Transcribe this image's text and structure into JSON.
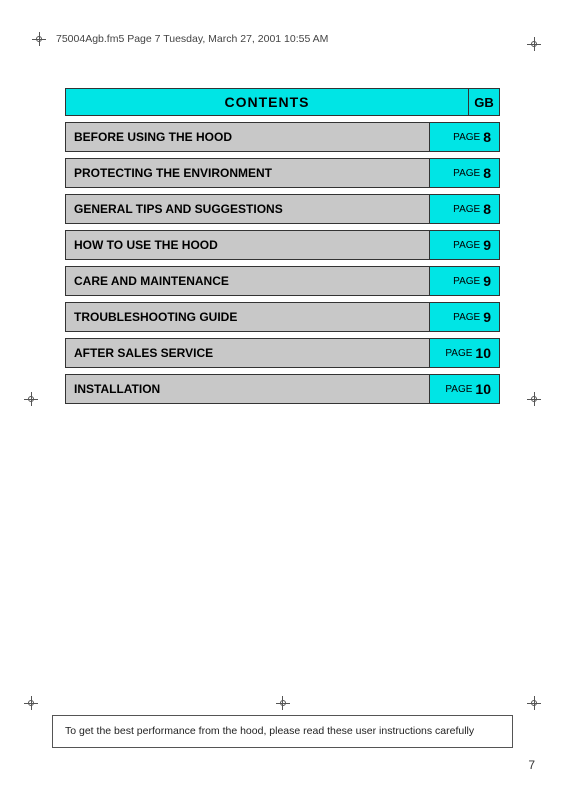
{
  "header": {
    "file_info": "75004Agb.fm5  Page 7  Tuesday, March 27, 2001  10:55 AM"
  },
  "contents": {
    "title": "CONTENTS",
    "gb_label": "GB",
    "rows": [
      {
        "label": "BEFORE USING THE HOOD",
        "page_word": "PAGE",
        "page_num": "8"
      },
      {
        "label": "PROTECTING THE ENVIRONMENT",
        "page_word": "PAGE",
        "page_num": "8"
      },
      {
        "label": "GENERAL TIPS AND SUGGESTIONS",
        "page_word": "PAGE",
        "page_num": "8"
      },
      {
        "label": "HOW TO USE THE HOOD",
        "page_word": "PAGE",
        "page_num": "9"
      },
      {
        "label": "CARE AND MAINTENANCE",
        "page_word": "PAGE",
        "page_num": "9"
      },
      {
        "label": "TROUBLESHOOTING GUIDE",
        "page_word": "PAGE",
        "page_num": "9"
      },
      {
        "label": "AFTER SALES SERVICE",
        "page_word": "PAGE",
        "page_num": "10"
      },
      {
        "label": "INSTALLATION",
        "page_word": "PAGE",
        "page_num": "10"
      }
    ]
  },
  "footer": {
    "note": "To get the best performance from the hood, please read these user instructions carefully"
  },
  "page_number": "7"
}
